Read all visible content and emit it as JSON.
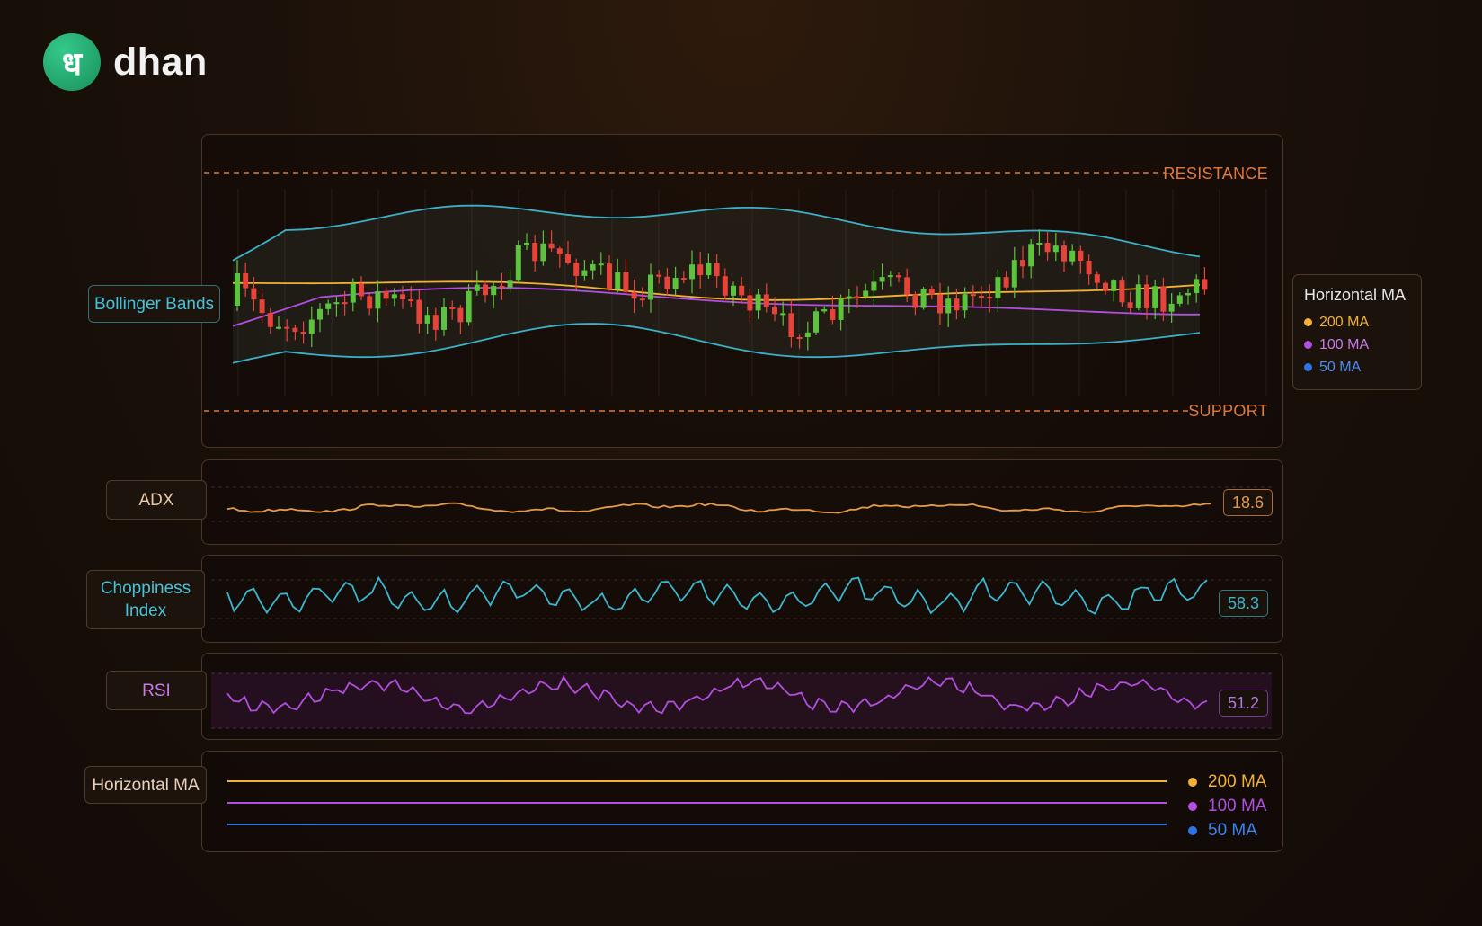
{
  "brand": {
    "logo_glyph": "ध",
    "name": "dhan",
    "color": "#1fa56b"
  },
  "main_chart": {
    "resistance_label": "RESISTANCE",
    "support_label": "SUPPORT",
    "bollinger_label": "Bollinger Bands",
    "legend": {
      "title": "Horizontal MA",
      "items": [
        {
          "label": "200 MA",
          "color": "#f2b233"
        },
        {
          "label": "100 MA",
          "color": "#b24fe0"
        },
        {
          "label": "50 MA",
          "color": "#2f74e6"
        }
      ]
    }
  },
  "indicators": {
    "adx": {
      "label": "ADX",
      "value": "18.6",
      "color": "#e39a4a"
    },
    "choppiness": {
      "label": "Choppiness Index",
      "value": "58.3",
      "color": "#3bb8cf"
    },
    "rsi": {
      "label": "RSI",
      "value": "51.2",
      "color": "#b24fe0"
    },
    "horizontal_ma": {
      "label": "Horizontal MA",
      "items": [
        {
          "label": "200 MA",
          "color": "#f2b233"
        },
        {
          "label": "100 MA",
          "color": "#b24fe0"
        },
        {
          "label": "50 MA",
          "color": "#2f74e6"
        }
      ]
    }
  },
  "colors": {
    "bull_candle": "#5cc43c",
    "bear_candle": "#e8433a",
    "band": "#3bb0c8",
    "resistance": "#e07a3a"
  }
}
